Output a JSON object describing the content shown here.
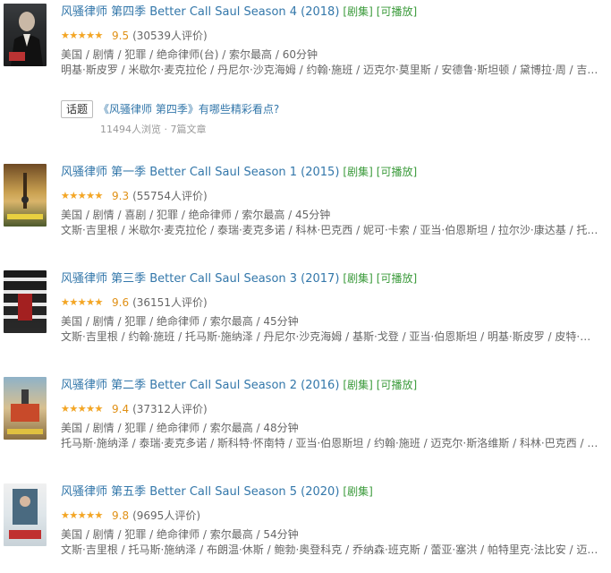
{
  "items": [
    {
      "title": "风骚律师 第四季 Better Call Saul Season 4 (2018)",
      "tags": [
        "[剧集]",
        "[可播放]"
      ],
      "rating": 0.95,
      "stars_text": "★★★★★",
      "score": "9.5",
      "count": "(30539人评价)",
      "meta": "美国 / 剧情 / 犯罪 / 绝命律师(台) / 索尔最高 / 60分钟",
      "cast": "明基·斯皮罗 / 米歇尔·麦克拉伦 / 丹尼尔·沙克海姆 / 约翰·施班 / 迈克尔·莫里斯 / 安德鲁·斯坦顿 / 黛博拉·周 / 吉姆..."
    },
    {
      "title": "风骚律师 第一季 Better Call Saul Season 1 (2015)",
      "tags": [
        "[剧集]",
        "[可播放]"
      ],
      "rating": 0.93,
      "stars_text": "★★★★★",
      "score": "9.3",
      "count": "(55754人评价)",
      "meta": "美国 / 剧情 / 喜剧 / 犯罪 / 绝命律师 / 索尔最高 / 45分钟",
      "cast": "文斯·吉里根 / 米歇尔·麦克拉伦 / 泰瑞·麦克多诺 / 科林·巴克西 / 妮可·卡索 / 亚当·伯恩斯坦 / 拉尔沙·康达基 / 托马..."
    },
    {
      "title": "风骚律师 第三季 Better Call Saul Season 3 (2017)",
      "tags": [
        "[剧集]",
        "[可播放]"
      ],
      "rating": 0.96,
      "stars_text": "★★★★★",
      "score": "9.6",
      "count": "(36151人评价)",
      "meta": "美国 / 剧情 / 犯罪 / 绝命律师 / 索尔最高 / 45分钟",
      "cast": "文斯·吉里根 / 约翰·施班 / 托马斯·施纳泽 / 丹尼尔·沙克海姆 / 基斯·戈登 / 亚当·伯恩斯坦 / 明基·斯皮罗 / 皮特·古尔..."
    },
    {
      "title": "风骚律师 第二季 Better Call Saul Season 2 (2016)",
      "tags": [
        "[剧集]",
        "[可播放]"
      ],
      "rating": 0.94,
      "stars_text": "★★★★★",
      "score": "9.4",
      "count": "(37312人评价)",
      "meta": "美国 / 剧情 / 犯罪 / 绝命律师 / 索尔最高 / 48分钟",
      "cast": "托马斯·施纳泽 / 泰瑞·麦克多诺 / 斯科特·怀南特 / 亚当·伯恩斯坦 / 约翰·施班 / 迈克尔·斯洛维斯 / 科林·巴克西 / 拉..."
    },
    {
      "title": "风骚律师 第五季 Better Call Saul Season 5 (2020)",
      "tags": [
        "[剧集]"
      ],
      "rating": 0.98,
      "stars_text": "★★★★★",
      "score": "9.8",
      "count": "(9695人评价)",
      "meta": "美国 / 剧情 / 犯罪 / 绝命律师 / 索尔最高 / 54分钟",
      "cast": "文斯·吉里根 / 托马斯·施纳泽 / 布朗温·休斯 / 鲍勃·奥登科克 / 乔纳森·班克斯 / 蕾亚·塞洪 / 帕特里克·法比安 / 迈克..."
    }
  ],
  "topic": {
    "badge": "话题",
    "title": "《风骚律师   第四季》有哪些精彩看点?",
    "stats": "11494人浏览 · 7篇文章"
  }
}
